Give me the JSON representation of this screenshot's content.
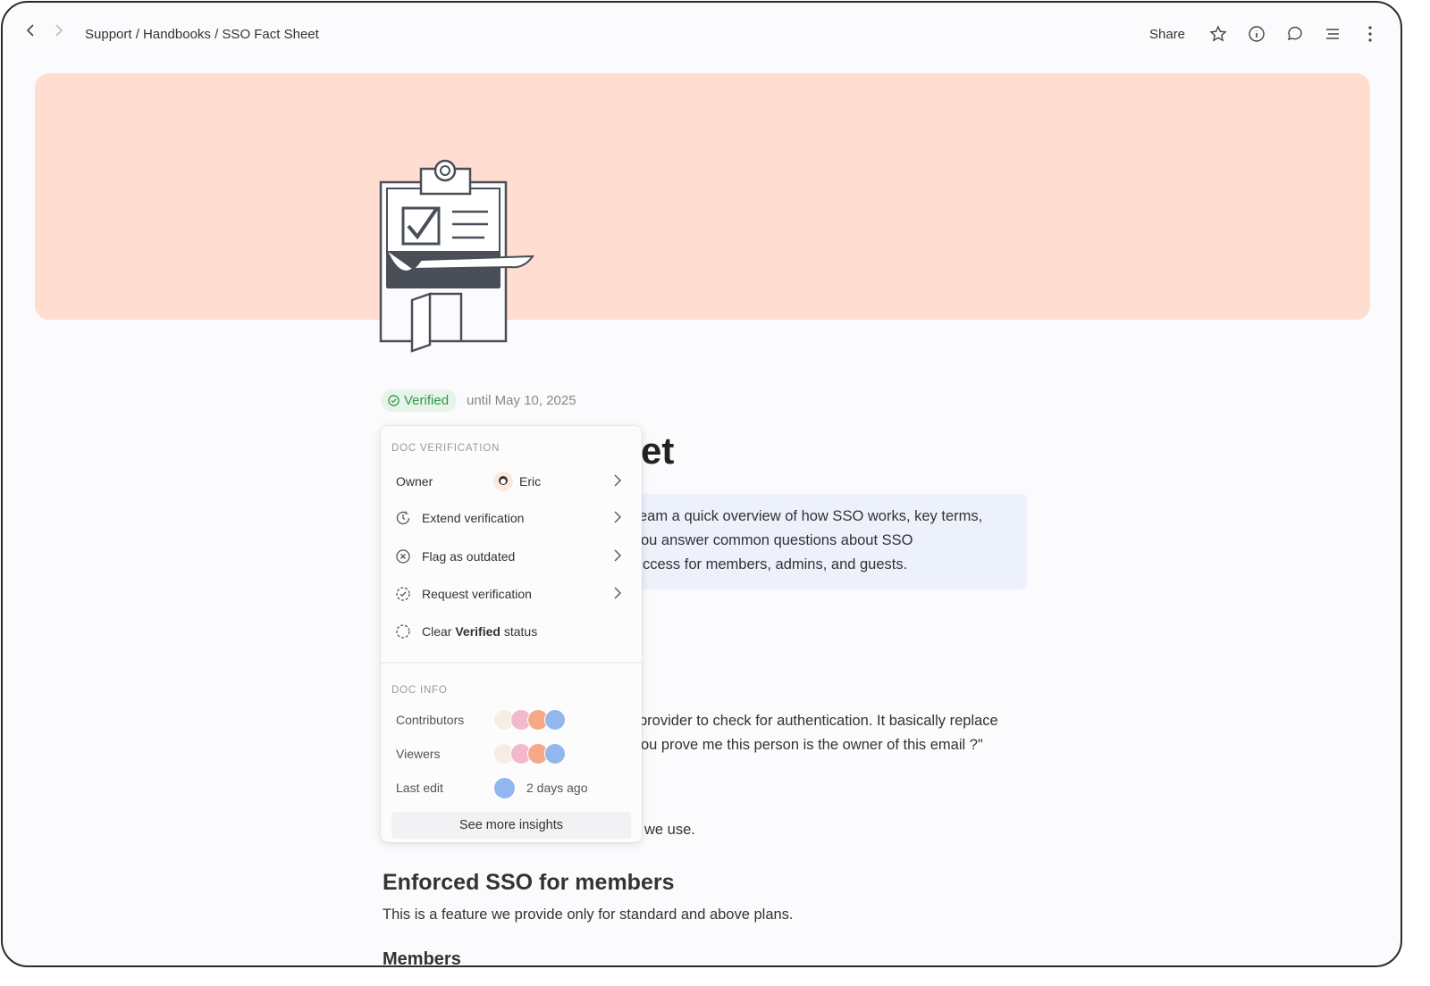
{
  "topbar": {
    "breadcrumb": "Support / Handbooks / SSO Fact Sheet",
    "share_label": "Share",
    "icons": [
      "back-icon",
      "forward-icon",
      "star-icon",
      "info-icon",
      "comment-icon",
      "outline-icon",
      "more-icon"
    ]
  },
  "banner": {
    "color": "#ffddd0",
    "illustration": "clipboard-checklist"
  },
  "verification": {
    "badge": "Verified",
    "until": "until May 10, 2025",
    "accent": "#2e9a47"
  },
  "document": {
    "title_visible": "et",
    "callout_lines": [
      "eam a quick overview of how SSO works, key terms,",
      "ou answer common questions about SSO",
      "ccess for members, admins, and guests."
    ],
    "para1_lines": [
      "provider to check for authentication. It basically replace",
      "ou prove me this person is the owner of this email ?\""
    ],
    "para2": "we use.",
    "heading": "Enforced SSO for members",
    "heading_text": "This is a feature we provide only for standard and above plans.",
    "subheading": "Members"
  },
  "popup": {
    "verification_header": "DOC VERIFICATION",
    "owner_label": "Owner",
    "owner_name": "Eric",
    "items": [
      {
        "label": "Extend verification",
        "icon": "clock-refresh-icon"
      },
      {
        "label": "Flag as outdated",
        "icon": "x-circle-icon"
      },
      {
        "label": "Request verification",
        "icon": "dashed-check-circle-icon"
      }
    ],
    "clear_prefix": "Clear ",
    "clear_bold": "Verified",
    "clear_suffix": " status",
    "info_header": "DOC INFO",
    "contributors_label": "Contributors",
    "viewers_label": "Viewers",
    "last_edit_label": "Last edit",
    "last_edit_value": "2 days ago",
    "insights_button": "See more insights"
  }
}
